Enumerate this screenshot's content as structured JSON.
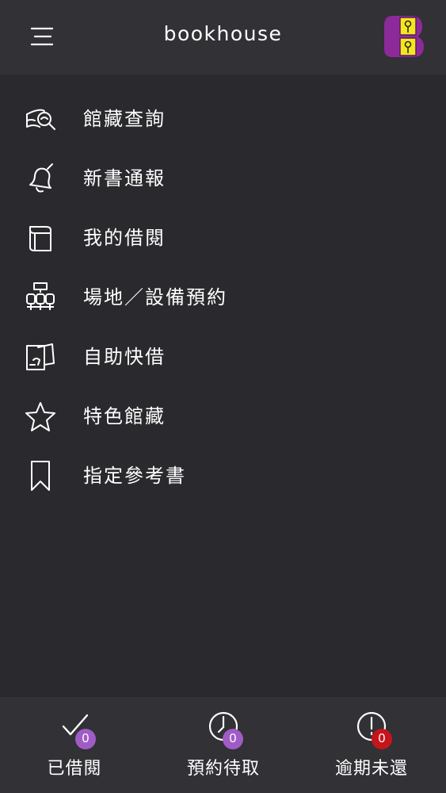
{
  "header": {
    "title": "bookhouse"
  },
  "nav": {
    "items": [
      {
        "label": "館藏查詢",
        "icon": "collection-search-icon"
      },
      {
        "label": "新書通報",
        "icon": "bell-icon"
      },
      {
        "label": "我的借閱",
        "icon": "books-icon"
      },
      {
        "label": "場地／設備預約",
        "icon": "venue-seats-icon"
      },
      {
        "label": "自助快借",
        "icon": "scan-card-icon"
      },
      {
        "label": "特色館藏",
        "icon": "star-icon"
      },
      {
        "label": "指定參考書",
        "icon": "bookmark-icon"
      }
    ]
  },
  "footer": {
    "items": [
      {
        "label": "已借閱",
        "count": "0",
        "icon": "checkmark-icon"
      },
      {
        "label": "預約待取",
        "count": "0",
        "icon": "clock-icon"
      },
      {
        "label": "逾期未還",
        "count": "0",
        "icon": "alert-icon"
      }
    ]
  },
  "colors": {
    "background": "#2a292d",
    "header": "#323135",
    "badge_purple": "#a05cc6",
    "badge_red": "#c6141c",
    "logo_purple": "#8d2a9a",
    "logo_yellow": "#f4e71c"
  }
}
